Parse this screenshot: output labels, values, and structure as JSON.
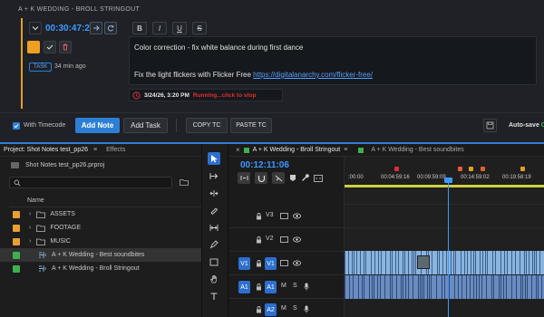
{
  "note": {
    "title": "A + K WEDDING - BROLL STRINGOUT",
    "timecode": "00:30:47:22",
    "format_buttons": [
      "B",
      "I",
      "U",
      "S"
    ],
    "tag": "TASK",
    "age": "34 min ago",
    "line1": "Color correction - fix white balance during first dance",
    "line2_prefix": "Fix the light flickers with Flicker Free ",
    "line2_link": "https://digitalanarchy.com/flicker-free/",
    "timer_date": "3/24/26, 3:20 PM",
    "timer_status": "Running...click to stop"
  },
  "toolbar": {
    "with_timecode": "With Timecode",
    "add_note": "Add Note",
    "add_task": "Add Task",
    "copy_tc": "COPY TC",
    "paste_tc": "PASTE TC",
    "autosave_label": "Auto-save",
    "autosave_state": "On"
  },
  "project": {
    "tab": "Project: Shot Notes test_pp26",
    "tab_effects": "Effects",
    "file": "Shot Notes test_pp26.prproj",
    "column_name": "Name",
    "items": [
      {
        "label": "ASSETS",
        "color": "#e8a030",
        "kind": "folder"
      },
      {
        "label": "FOOTAGE",
        "color": "#e8a030",
        "kind": "folder"
      },
      {
        "label": "MUSIC",
        "color": "#e8a030",
        "kind": "folder"
      },
      {
        "label": "A + K Wedding - Best soundbites",
        "color": "#3cb050",
        "kind": "sequence"
      },
      {
        "label": "A + K Wedding - Broll Stringout",
        "color": "#3cb050",
        "kind": "sequence"
      }
    ]
  },
  "timeline": {
    "tab1": "A + K Wedding - Broll Stringout",
    "tab2": "A + K Wedding - Best soundbites",
    "timecode": "00:12:11:06",
    "ruler": [
      ":00:00",
      "00:04:59:16",
      "00:09:59:09",
      "00:14:59:02",
      "00:19:58:19"
    ],
    "tracks": [
      {
        "src": "",
        "label": "V3",
        "kind": "video"
      },
      {
        "src": "",
        "label": "V2",
        "kind": "video"
      },
      {
        "src": "V1",
        "label": "V1",
        "kind": "video"
      },
      {
        "src": "A1",
        "label": "A1",
        "kind": "audio",
        "m": "M",
        "s": "S"
      },
      {
        "src": "",
        "label": "A2",
        "kind": "audio",
        "m": "M",
        "s": "S"
      }
    ]
  },
  "colors": {
    "accent": "#e0a020",
    "blue": "#2d7fd6",
    "timecode": "#3b9aff",
    "running": "#e03030",
    "green": "#35c050"
  }
}
